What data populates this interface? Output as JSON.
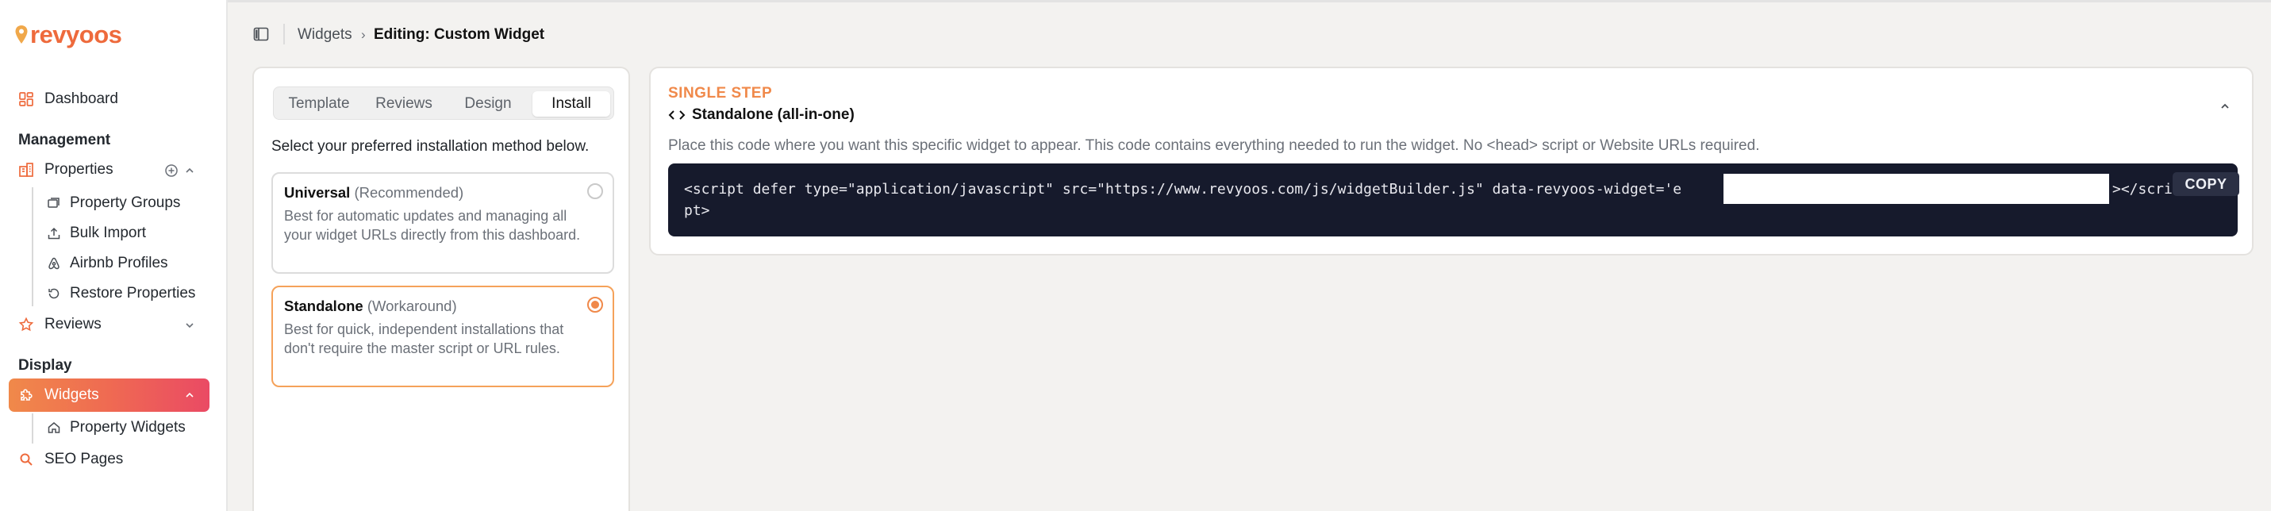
{
  "brand": {
    "name": "revyoos",
    "color": "#ee6a3c"
  },
  "sidebar": {
    "dashboard": "Dashboard",
    "management_title": "Management",
    "properties": "Properties",
    "property_sub": [
      "Property Groups",
      "Bulk Import",
      "Airbnb Profiles",
      "Restore Properties"
    ],
    "reviews": "Reviews",
    "display_title": "Display",
    "widgets": "Widgets",
    "widget_sub": [
      "Property Widgets"
    ],
    "seo": "SEO Pages"
  },
  "breadcrumb": {
    "parent": "Widgets",
    "separator": "›",
    "current": "Editing: Custom Widget"
  },
  "tabs": [
    {
      "label": "Template",
      "active": false
    },
    {
      "label": "Reviews",
      "active": false
    },
    {
      "label": "Design",
      "active": false
    },
    {
      "label": "Install",
      "active": true
    }
  ],
  "install": {
    "hint": "Select your preferred installation method below.",
    "options": [
      {
        "title": "Universal",
        "tag": "(Recommended)",
        "description": "Best for automatic updates and managing all your widget URLs directly from this dashboard.",
        "selected": false
      },
      {
        "title": "Standalone",
        "tag": "(Workaround)",
        "description": "Best for quick, independent installations that don't require the master script or URL rules.",
        "selected": true
      }
    ]
  },
  "snippet": {
    "eyebrow": "SINGLE STEP",
    "title": "Standalone (all-in-one)",
    "description": "Place this code where you want this specific widget to appear. This code contains everything needed to run the widget. No <head> script or Website URLs required.",
    "code_line1": "<script defer type=\"application/javascript\" src=\"https://www.revyoos.com/js/widgetBuilder.js\" data-revyoos-widget='e",
    "code_tail": "></scri",
    "code_line2": "pt>",
    "copy_label": "COPY"
  },
  "colors": {
    "accent": "#f0894a",
    "active_gradient_end": "#ea4a64",
    "code_bg": "#161a2c"
  }
}
